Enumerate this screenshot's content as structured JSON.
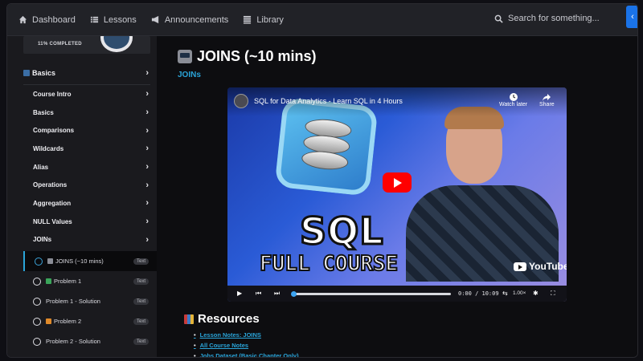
{
  "nav": {
    "items": [
      {
        "label": "Dashboard",
        "icon": "home-icon"
      },
      {
        "label": "Lessons",
        "icon": "list-icon"
      },
      {
        "label": "Announcements",
        "icon": "megaphone-icon"
      },
      {
        "label": "Library",
        "icon": "library-icon"
      }
    ],
    "search_placeholder": "Search for something...",
    "collapse_icon": "chevron-left-icon"
  },
  "sidebar": {
    "progress_text": "11% COMPLETED",
    "progress_percent": 11,
    "section_title": "Basics",
    "menu": [
      "Course Intro",
      "Basics",
      "Comparisons",
      "Wildcards",
      "Alias",
      "Operations",
      "Aggregation",
      "NULL Values",
      "JOINs"
    ],
    "lessons": [
      {
        "label": "JOINS (~10 mins)",
        "tag": "Text",
        "active": true,
        "icon_color": "#8a8d96"
      },
      {
        "label": "Problem 1",
        "tag": "Text",
        "active": false,
        "icon_color": "#3aa55a"
      },
      {
        "label": "Problem 1 - Solution",
        "tag": "Text",
        "active": false,
        "icon_color": ""
      },
      {
        "label": "Problem 2",
        "tag": "Text",
        "active": false,
        "icon_color": "#e08a2a"
      },
      {
        "label": "Problem 2 - Solution",
        "tag": "Text",
        "active": false,
        "icon_color": ""
      }
    ]
  },
  "main": {
    "title": "JOINS (~10 mins)",
    "sub_link": "JOINs",
    "video": {
      "title": "SQL for Data Analytics - Learn SQL in 4 Hours",
      "watch_later": "Watch later",
      "share": "Share",
      "big_text_1": "SQL",
      "big_text_2": "FULL COURSE",
      "logo_text": "YouTube",
      "time": "0:00 / 10:09",
      "speed": "1.00×",
      "progress_fraction": 0
    },
    "resources_title": "Resources",
    "resources": [
      "Lesson Notes: JOINS",
      "All Course Notes",
      "Jobs Dataset (Basic Chapter Only)"
    ]
  }
}
